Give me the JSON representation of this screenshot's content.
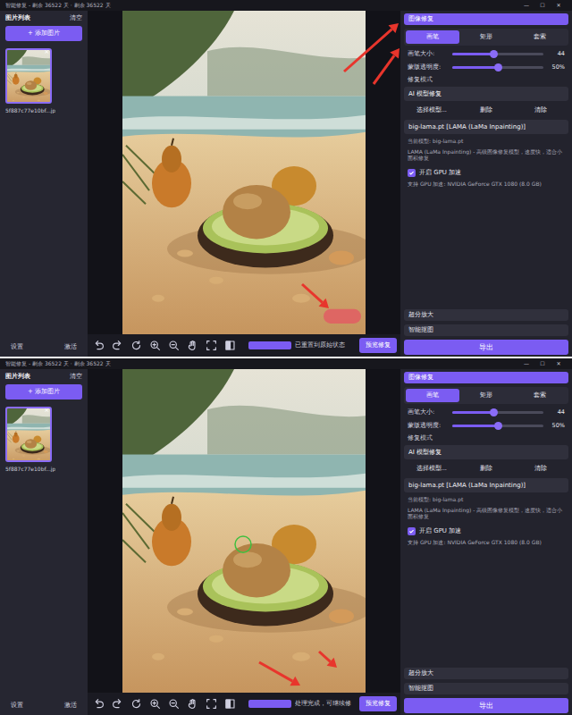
{
  "screens": [
    {
      "window": {
        "title": "智能修复 - 剩余 36522 天 · 剩余 36522 天",
        "controls": [
          "—",
          "☐",
          "✕"
        ]
      },
      "sidebar": {
        "title": "图片列表",
        "clear": "清空",
        "add": "+ 添加图片",
        "images": [
          {
            "filename": "5f887c77e10bf...jp",
            "close": "×",
            "selected": true
          }
        ],
        "footer": [
          "设置",
          "激活"
        ]
      },
      "canvas": {
        "watermark": true,
        "brush_cursor": false
      },
      "toolbar": {
        "progress": {
          "level": 1
        },
        "status": "已重置到原始状态",
        "preview": "预览修复"
      },
      "panel": {
        "header": "图像修复",
        "expanded": true,
        "tabs": [
          {
            "label": "画笔",
            "selected": true
          },
          {
            "label": "矩形",
            "selected": false
          },
          {
            "label": "套索",
            "selected": false
          }
        ],
        "sliders": [
          {
            "label": "画笔大小:",
            "level": 0.45,
            "reading": "44"
          },
          {
            "label": "蒙版透明度:",
            "level": 0.5,
            "reading": "50%"
          }
        ],
        "mode_label": "修复模式",
        "mode": "AI 模型修复",
        "model_buttons": [
          "选择模型...",
          "删除",
          "清除"
        ],
        "model": "big-lama.pt [LAMA (LaMa Inpainting)]",
        "current_model": "当前模型: big-lama.pt",
        "description": "LAMA (LaMa Inpainting) - 高级图像修复模型，速度快，适合小面积修复",
        "gpu": {
          "label": "开启 GPU 加速",
          "checked": true
        },
        "gpu_info": "支持 GPU 加速: NVIDIA GeForce GTX 1080 (8.0 GB)",
        "sections": [
          {
            "label": "超分放大",
            "expanded": false
          },
          {
            "label": "智能抠图",
            "expanded": false
          }
        ],
        "export": "导出"
      },
      "annotations": [
        {
          "kind": "header"
        },
        {
          "kind": "tabs"
        },
        {
          "kind": "watermark"
        }
      ]
    },
    {
      "window": {
        "title": "智能修复 - 剩余 36522 天 · 剩余 36522 天",
        "controls": [
          "—",
          "☐",
          "✕"
        ]
      },
      "sidebar": {
        "title": "图片列表",
        "clear": "清空",
        "add": "+ 添加图片",
        "images": [
          {
            "filename": "5f887c77e10bf...jp",
            "close": "×",
            "selected": true
          }
        ],
        "footer": [
          "设置",
          "激活"
        ]
      },
      "canvas": {
        "watermark": false,
        "brush_cursor": true
      },
      "toolbar": {
        "progress": {
          "level": 1
        },
        "status": "处理完成，可继续修",
        "preview": "预览修复"
      },
      "panel": {
        "header": "图像修复",
        "expanded": true,
        "tabs": [
          {
            "label": "画笔",
            "selected": true
          },
          {
            "label": "矩形",
            "selected": false
          },
          {
            "label": "套索",
            "selected": false
          }
        ],
        "sliders": [
          {
            "label": "画笔大小:",
            "level": 0.45,
            "reading": "44"
          },
          {
            "label": "蒙版透明度:",
            "level": 0.5,
            "reading": "50%"
          }
        ],
        "mode_label": "修复模式",
        "mode": "AI 模型修复",
        "model_buttons": [
          "选择模型...",
          "删除",
          "清除"
        ],
        "model": "big-lama.pt [LAMA (LaMa Inpainting)]",
        "current_model": "当前模型: big-lama.pt",
        "description": "LAMA (LaMa Inpainting) - 高级图像修复模型，速度快，适合小面积修复",
        "gpu": {
          "label": "开启 GPU 加速",
          "checked": true
        },
        "gpu_info": "支持 GPU 加速: NVIDIA GeForce GTX 1080 (8.0 GB)",
        "sections": [
          {
            "label": "超分放大",
            "expanded": false
          },
          {
            "label": "智能抠图",
            "expanded": false
          }
        ],
        "export": "导出"
      },
      "annotations": [
        {
          "kind": "sand-left"
        },
        {
          "kind": "sand-right"
        }
      ]
    }
  ]
}
